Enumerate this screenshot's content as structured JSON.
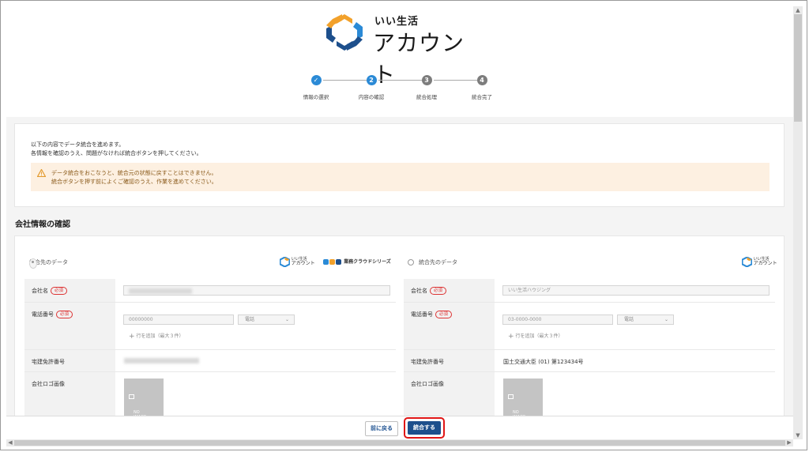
{
  "brand": {
    "small": "いい生活",
    "large": "アカウント",
    "colors": {
      "orange": "#F2A12B",
      "blue": "#2B8AD6",
      "navy": "#1D4F8C"
    }
  },
  "stepper": {
    "steps": [
      {
        "num": "✓",
        "label": "情報の選択",
        "state": "done"
      },
      {
        "num": "2",
        "label": "内容の確認",
        "state": "active"
      },
      {
        "num": "3",
        "label": "統合処理",
        "state": "todo"
      },
      {
        "num": "4",
        "label": "統合完了",
        "state": "todo"
      }
    ]
  },
  "notice": {
    "line1": "以下の内容でデータ統合を進めます。",
    "line2": "各情報を確認のうえ、問題がなければ統合ボタンを押してください。",
    "warning_line1": "データ統合をおこなうと、統合元の状態に戻すことはできません。",
    "warning_line2": "統合ボタンを押す前によくご確認のうえ、作業を進めてください。"
  },
  "section_title": "会社情報の確認",
  "columns": {
    "source_label": "統合先のデータ",
    "target_label": "統合先のデータ",
    "mini_logo_small": "いい生活",
    "mini_logo_large": "アカウント",
    "series_label": "業務クラウドシリーズ"
  },
  "fields": {
    "company_name": "会社名",
    "phone": "電話番号",
    "license": "宅建免許番号",
    "logo": "会社ロゴ画像",
    "required": "必須"
  },
  "target_values": {
    "company_name_placeholder": "いい生活ハウジング",
    "phone_placeholder": "03-0000-0000",
    "license": "国土交通大臣 (01) 第123434号"
  },
  "source_values": {
    "phone_placeholder": "00000000"
  },
  "phone_type": "電話",
  "add_row": "行を追加（最大３件）",
  "no_image": "NO IMAGE",
  "buttons": {
    "back": "前に戻る",
    "merge": "統合する"
  }
}
